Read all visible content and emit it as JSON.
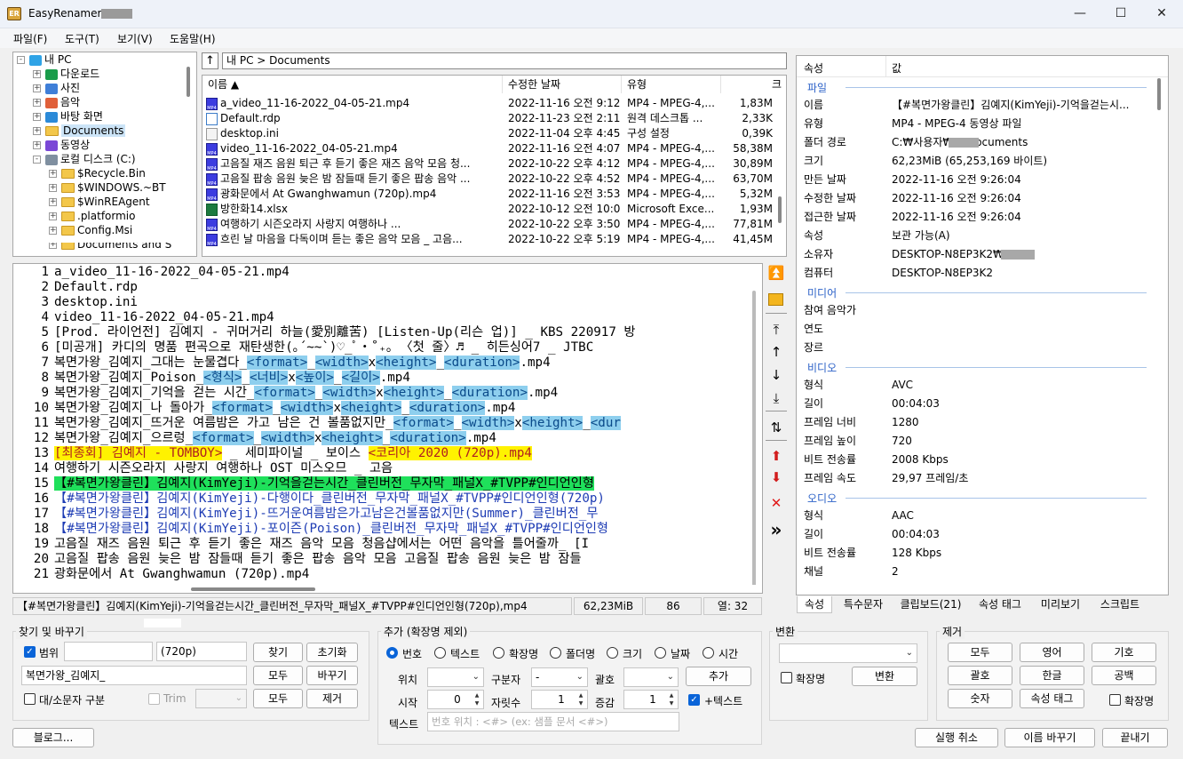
{
  "window": {
    "title": "EasyRenamer",
    "minimize": "—",
    "maximize": "☐",
    "close": "✕"
  },
  "menu": [
    "파일(F)",
    "도구(T)",
    "보기(V)",
    "도움말(H)"
  ],
  "tree": [
    {
      "label": "내 PC",
      "icon": "pc-icon"
    },
    {
      "label": "다운로드",
      "icon": "download-icon"
    },
    {
      "label": "사진",
      "icon": "pictures-icon"
    },
    {
      "label": "음악",
      "icon": "music-icon"
    },
    {
      "label": "바탕 화면",
      "icon": "desktop-icon"
    },
    {
      "label": "Documents",
      "icon": "folder-icon"
    },
    {
      "label": "동영상",
      "icon": "video-icon"
    },
    {
      "label": "로컬 디스크 (C:)",
      "icon": "drive-icon"
    },
    {
      "label": "$Recycle.Bin",
      "icon": "folder-icon"
    },
    {
      "label": "$WINDOWS.~BT",
      "icon": "folder-icon"
    },
    {
      "label": "$WinREAgent",
      "icon": "folder-icon"
    },
    {
      "label": ".platformio",
      "icon": "folder-icon"
    },
    {
      "label": "Config.Msi",
      "icon": "folder-icon"
    },
    {
      "label": "Documents and S",
      "icon": "folder-icon"
    }
  ],
  "address": {
    "path": "내 PC > Documents",
    "up": "↑"
  },
  "file_list": {
    "columns": [
      "이름 ▲",
      "수정한 날짜",
      "유형",
      "크"
    ],
    "rows": [
      [
        "a_video_11-16-2022_04-05-21.mp4",
        "2022-11-16 오전 9:12",
        "MP4 - MPEG-4,...",
        "1,83M"
      ],
      [
        "Default.rdp",
        "2022-11-23 오전 2:11",
        "원격 데스크톱 ...",
        "2,33K"
      ],
      [
        "desktop.ini",
        "2022-11-04 오후 4:45",
        "구성 설정",
        "0,39K"
      ],
      [
        "video_11-16-2022_04-05-21.mp4",
        "2022-11-16 오전 4:07",
        "MP4 - MPEG-4,...",
        "58,38M"
      ],
      [
        "고음질 재즈 음원 퇴근 후 듣기 좋은 재즈 음악 모음 청...",
        "2022-10-22 오후 4:12",
        "MP4 - MPEG-4,...",
        "30,89M"
      ],
      [
        "고음질 팝송 음원 늦은 밤 잠들때 듣기 좋은 팝송 음악 ...",
        "2022-10-22 오후 4:52",
        "MP4 - MPEG-4,...",
        "63,70M"
      ],
      [
        "광화문에서 At Gwanghwamun (720p).mp4",
        "2022-11-16 오전 3:53",
        "MP4 - MPEG-4,...",
        "5,32M"
      ],
      [
        "방한화14.xlsx",
        "2022-10-12 오전 10:09",
        "Microsoft Exce...",
        "1,93M"
      ],
      [
        "여행하기 시즌오라지 사랑지 여행하나 ...",
        "2022-10-22 오후 3:50",
        "MP4 - MPEG-4,...",
        "77,81M"
      ],
      [
        "흐린 날 마음을 다독이며 듣는 좋은 음악 모음 _ 고음...",
        "2022-10-22 오후 5:19",
        "MP4 - MPEG-4,...",
        "41,45M"
      ]
    ]
  },
  "properties": {
    "header_key": "속성",
    "header_val": "값",
    "sec_file": "파일",
    "sec_media": "미디어",
    "sec_video": "비디오",
    "sec_audio": "오디오",
    "file": [
      [
        "이름",
        "【#복면가왕클린】김예지(KimYeji)-기억을걷는시..."
      ],
      [
        "유형",
        "MP4 - MPEG-4 동영상 파일"
      ],
      [
        "폴더 경로",
        "C:₩사용자₩      ₩Documents"
      ],
      [
        "크기",
        "62,23MiB (65,253,169 바이트)"
      ],
      [
        "만든 날짜",
        "2022-11-16 오전 9:26:04"
      ],
      [
        "수정한 날짜",
        "2022-11-16 오전 9:26:04"
      ],
      [
        "접근한 날짜",
        "2022-11-16 오전 9:26:04"
      ],
      [
        "속성",
        "보관 가능(A)"
      ],
      [
        "소유자",
        "DESKTOP-N8EP3K2₩"
      ],
      [
        "컴퓨터",
        "DESKTOP-N8EP3K2"
      ]
    ],
    "media": [
      [
        "참여 음악가",
        ""
      ],
      [
        "연도",
        ""
      ],
      [
        "장르",
        ""
      ]
    ],
    "video": [
      [
        "형식",
        "AVC"
      ],
      [
        "길이",
        "00:04:03"
      ],
      [
        "프레임 너비",
        "1280"
      ],
      [
        "프레임 높이",
        "720"
      ],
      [
        "비트 전송률",
        "2008 Kbps"
      ],
      [
        "프레임 속도",
        "29,97 프레임/초"
      ]
    ],
    "audio": [
      [
        "형식",
        "AAC"
      ],
      [
        "길이",
        "00:04:03"
      ],
      [
        "비트 전송률",
        "128 Kbps"
      ],
      [
        "채널",
        "2"
      ]
    ],
    "tabs": [
      "속성",
      "특수문자",
      "클립보드(21)",
      "속성 태그",
      "미리보기",
      "스크립트"
    ]
  },
  "editor_lines": [
    [
      {
        "t": "a_video_11-16-2022_04-05-21.mp4"
      }
    ],
    [
      {
        "t": "Default.rdp"
      }
    ],
    [
      {
        "t": "desktop.ini"
      }
    ],
    [
      {
        "t": "video_11-16-2022_04-05-21.mp4"
      }
    ],
    [
      {
        "t": "[Prod. 라이언전] 김예지 - 귀머거리 하늘(愛別離苦) [Listen-Up(리슨 업)] _ KBS 220917 방"
      }
    ],
    [
      {
        "t": "[미공개] 카디의 명품 편곡으로 재탄생한(｡´~~`)♡_ﾟ‧˚₊｡ 〈첫 줄〉♬ _ 히든싱어7 _ JTBC"
      }
    ],
    [
      {
        "t": "복면가왕_김예지_그대는 눈물겹다_"
      },
      {
        "t": "<format>",
        "c": "tg"
      },
      {
        "t": "_"
      },
      {
        "t": "<width>",
        "c": "tg"
      },
      {
        "t": "x"
      },
      {
        "t": "<height>",
        "c": "tg"
      },
      {
        "t": "_"
      },
      {
        "t": "<duration>",
        "c": "tg"
      },
      {
        "t": ".mp4"
      }
    ],
    [
      {
        "t": "복면가왕_김예지_Poison_"
      },
      {
        "t": "<형식>",
        "c": "tg"
      },
      {
        "t": "_"
      },
      {
        "t": "<너비>",
        "c": "tg"
      },
      {
        "t": "x"
      },
      {
        "t": "<높이>",
        "c": "tg"
      },
      {
        "t": "_"
      },
      {
        "t": "<길이>",
        "c": "tg"
      },
      {
        "t": ".mp4"
      }
    ],
    [
      {
        "t": "복면가왕_김예지_기억을 걷는 시간_"
      },
      {
        "t": "<format>",
        "c": "tg"
      },
      {
        "t": "_"
      },
      {
        "t": "<width>",
        "c": "tg"
      },
      {
        "t": "x"
      },
      {
        "t": "<height>",
        "c": "tg"
      },
      {
        "t": "_"
      },
      {
        "t": "<duration>",
        "c": "tg"
      },
      {
        "t": ".mp4"
      }
    ],
    [
      {
        "t": "복면가왕_김예지_나 돌아가_"
      },
      {
        "t": "<format>",
        "c": "tg"
      },
      {
        "t": "_"
      },
      {
        "t": "<width>",
        "c": "tg"
      },
      {
        "t": "x"
      },
      {
        "t": "<height>",
        "c": "tg"
      },
      {
        "t": "_"
      },
      {
        "t": "<duration>",
        "c": "tg"
      },
      {
        "t": ".mp4"
      }
    ],
    [
      {
        "t": "복면가왕_김예지_뜨거운 여름밤은 가고 남은 건 볼품없지만_"
      },
      {
        "t": "<format>",
        "c": "tg"
      },
      {
        "t": "_"
      },
      {
        "t": "<width>",
        "c": "tg"
      },
      {
        "t": "x"
      },
      {
        "t": "<height>",
        "c": "tg"
      },
      {
        "t": "_"
      },
      {
        "t": "<dur",
        "c": "tg"
      }
    ],
    [
      {
        "t": "복면가왕_김예지_으르렁_"
      },
      {
        "t": "<format>",
        "c": "tg"
      },
      {
        "t": "_"
      },
      {
        "t": "<width>",
        "c": "tg"
      },
      {
        "t": "x"
      },
      {
        "t": "<height>",
        "c": "tg"
      },
      {
        "t": "_"
      },
      {
        "t": "<duration>",
        "c": "tg"
      },
      {
        "t": ".mp4"
      }
    ],
    [
      {
        "t": "[최종회] 김예지 - TOMBOY>",
        "c": "yl"
      },
      {
        "t": " _ 세미파이널 _ 보이스 "
      },
      {
        "t": "<코리아 2020 (720p).mp4",
        "c": "yl"
      }
    ],
    [
      {
        "t": "여행하기 시즌오라지 사랑지 여행하나 OST 미스오므 _ 고음"
      }
    ],
    [
      {
        "t": "【#복면가왕클린】김예지(KimYeji)-기억을걷는시간_클린버전_무자막_패널X_#TVPP#인디언인형",
        "c": "gr"
      }
    ],
    [
      {
        "t": "【#복면가왕클린】김예지(KimYeji)-다행이다_클린버전_무자막_패널X_#TVPP#인디언인형(720p)",
        "c": "bl"
      }
    ],
    [
      {
        "t": "【#복면가왕클린】김예지(KimYeji)-뜨거운여름밤은가고남은건볼품없지만(Summer)_클린버전_무",
        "c": "bl"
      }
    ],
    [
      {
        "t": "【#복면가왕클린】김예지(KimYeji)-포이즌(Poison)_클린버전_무자막_패널X_#TVPP#인디언인형",
        "c": "bl"
      }
    ],
    [
      {
        "t": "고음질 재즈 음원 퇴근 후 듣기 좋은 재즈 음악 모음 청음샵에서는 어떤 음악을 틀어줄까_ [I"
      }
    ],
    [
      {
        "t": "고음질 팝송 음원 늦은 밤 잠들때 듣기 좋은 팝송 음악 모음 고음질 팝송 음원 늦은 밤 잠들"
      }
    ],
    [
      {
        "t": "광화문에서 At Gwanghwamun (720p).mp4"
      }
    ]
  ],
  "statusbar": [
    "【#복면가왕클린】김예지(KimYeji)-기억을걷는시간_클린버전_무자막_패널X_#TVPP#인디언인형(720p),mp4",
    "62,23MiB",
    "86",
    "열: 32"
  ],
  "find": {
    "title": "찾기 및 바꾸기",
    "range": "범위",
    "find_value": "(720p)",
    "find_btn": "찾기",
    "reset_btn": "초기화",
    "replace_value": "복면가왕_김예지_",
    "all_btn1": "모두",
    "replace_btn": "바꾸기",
    "case": "대/소문자 구분",
    "trim": "Trim",
    "all_btn2": "모두",
    "remove_btn": "제거"
  },
  "add": {
    "title": "추가 (확장명 제외)",
    "radios": [
      "번호",
      "텍스트",
      "확장명",
      "폴더명",
      "크기",
      "날짜",
      "시간"
    ],
    "position": "위치",
    "separator": "구분자",
    "separator_value": "-",
    "bracket": "괄호",
    "add_btn": "추가",
    "start": "시작",
    "start_value": "0",
    "digits": "자릿수",
    "digits_value": "1",
    "step": "증감",
    "step_value": "1",
    "plus_text": "+텍스트",
    "text": "텍스트",
    "text_placeholder": "번호 위치 : <#> (ex: 샘플 문서 <#>)"
  },
  "convert": {
    "title": "변환",
    "ext": "확장명",
    "btn": "변환"
  },
  "remove": {
    "title": "제거",
    "buttons": [
      "모두",
      "영어",
      "기호",
      "괄호",
      "한글",
      "공백",
      "숫자",
      "속성 태그"
    ],
    "ext": "확장명"
  },
  "bottom": {
    "blog": "블로그...",
    "undo": "실행 취소",
    "rename": "이름 바꾸기",
    "exit": "끝내기"
  },
  "tools": [
    "⏫",
    "📂",
    "⤒",
    "↑",
    "↓",
    "⤓",
    "⇅",
    "⬆",
    "⬇",
    "✕",
    "»"
  ]
}
